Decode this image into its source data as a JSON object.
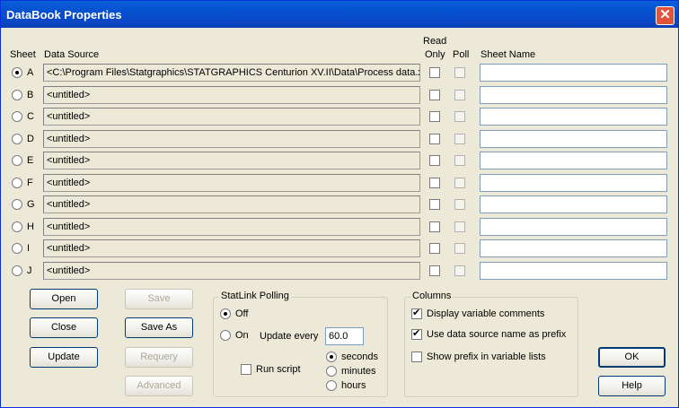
{
  "window": {
    "title": "DataBook Properties",
    "close_glyph": "✕"
  },
  "headers": {
    "sheet": "Sheet",
    "data_source": "Data Source",
    "read": "Read",
    "only": "Only",
    "poll": "Poll",
    "sheet_name": "Sheet Name"
  },
  "rows": [
    {
      "letter": "A",
      "source": "<C:\\Program Files\\Statgraphics\\STATGRAPHICS Centurion XV.II\\Data\\Process data.x",
      "selected": true
    },
    {
      "letter": "B",
      "source": "<untitled>",
      "selected": false
    },
    {
      "letter": "C",
      "source": "<untitled>",
      "selected": false
    },
    {
      "letter": "D",
      "source": "<untitled>",
      "selected": false
    },
    {
      "letter": "E",
      "source": "<untitled>",
      "selected": false
    },
    {
      "letter": "F",
      "source": "<untitled>",
      "selected": false
    },
    {
      "letter": "G",
      "source": "<untitled>",
      "selected": false
    },
    {
      "letter": "H",
      "source": "<untitled>",
      "selected": false
    },
    {
      "letter": "I",
      "source": "<untitled>",
      "selected": false
    },
    {
      "letter": "J",
      "source": "<untitled>",
      "selected": false
    }
  ],
  "buttons": {
    "open": "Open",
    "close": "Close",
    "update": "Update",
    "save": "Save",
    "save_as": "Save As",
    "requery": "Requery",
    "advanced": "Advanced",
    "ok": "OK",
    "help": "Help"
  },
  "statlink": {
    "title": "StatLink Polling",
    "off": "Off",
    "on": "On",
    "mode": "Off",
    "update_every": "Update every",
    "interval": "60.0",
    "run_script": "Run script",
    "seconds": "seconds",
    "minutes": "minutes",
    "hours": "hours",
    "unit": "seconds"
  },
  "columns": {
    "title": "Columns",
    "display_comments": "Display variable comments",
    "use_prefix": "Use data source name as prefix",
    "show_prefix": "Show prefix in variable lists"
  },
  "colors": {
    "titlebar": "#0550d0",
    "dialog_bg": "#ece9d8",
    "close_button": "#e3523a"
  }
}
